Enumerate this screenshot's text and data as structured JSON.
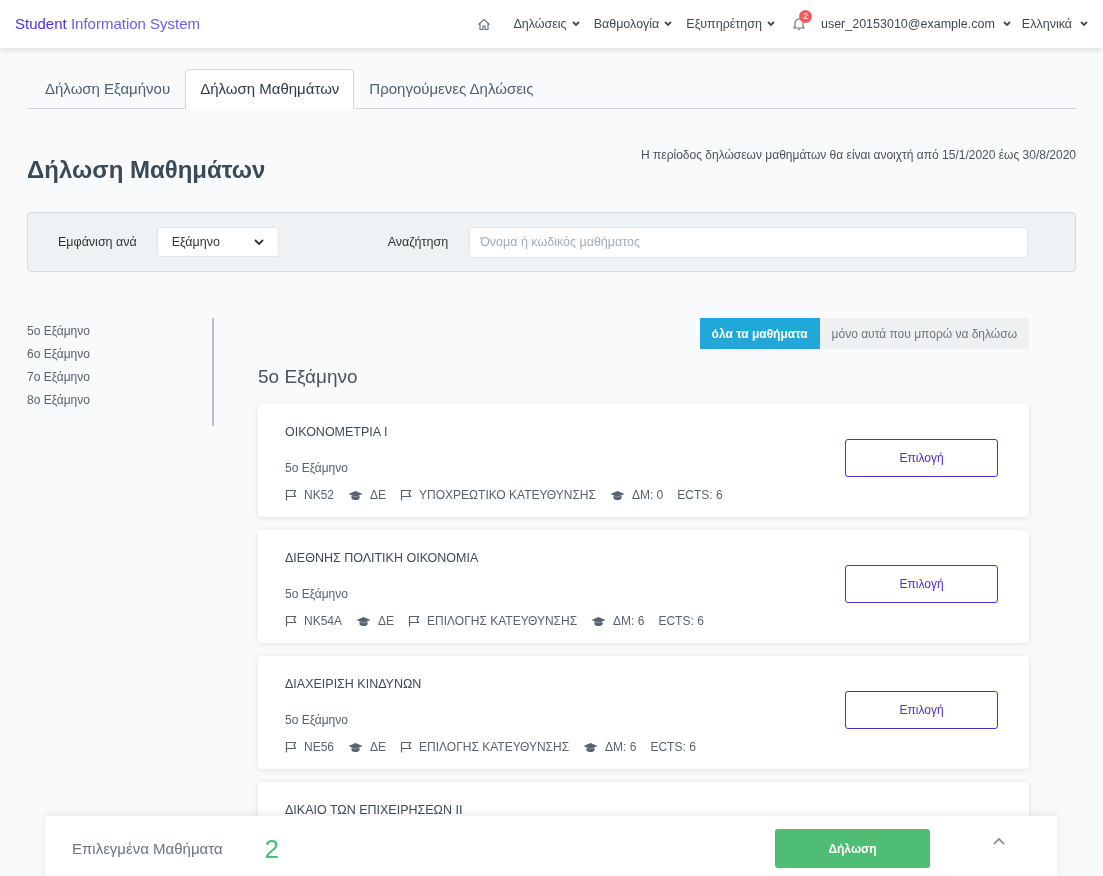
{
  "navbar": {
    "brand_first": "Student",
    "brand_rest": "Information System",
    "menus": [
      {
        "label": "Δηλώσεις"
      },
      {
        "label": "Βαθμολογία"
      },
      {
        "label": "Εξυπηρέτηση"
      }
    ],
    "notifications": "2",
    "user": "user_20153010@example.com",
    "language": "Ελληνικά"
  },
  "tabs": [
    {
      "label": "Δήλωση Εξαμήνου",
      "selected": false
    },
    {
      "label": "Δήλωση Μαθημάτων",
      "selected": true
    },
    {
      "label": "Προηγούμενες Δηλώσεις",
      "selected": false
    }
  ],
  "heading": "Δήλωση Μαθημάτων",
  "period_note": "Η περίοδος δηλώσεων μαθημάτων θα είναι ανοιχτή από 15/1/2020 έως 30/8/2020",
  "filters": {
    "show_by_label": "Εμφάνιση ανά",
    "show_by_value": "Εξάμηνο",
    "search_label": "Αναζήτηση",
    "search_placeholder": "Όνομα ή κωδικός μαθήματος"
  },
  "semesters": [
    "5ο Εξάμηνο",
    "6ο Εξάμηνο",
    "7ο Εξάμηνο",
    "8ο Εξάμηνο"
  ],
  "toggle": [
    {
      "label": "όλα τα μαθήματα",
      "selected": true
    },
    {
      "label": "μόνο αυτά που μπορώ να δηλώσω",
      "selected": false
    }
  ],
  "section_title": "5ο Εξάμηνο",
  "courses": [
    {
      "title": "ΟΙΚΟΝΟΜΕΤΡΙΑ Ι",
      "semester": "5ο Εξάμηνο",
      "button": "Επιλογή",
      "meta": [
        {
          "kind": "flag",
          "text": "NK52"
        },
        {
          "kind": "cap",
          "text": "ΔΕ"
        },
        {
          "kind": "flag",
          "text": "ΥΠΟΧΡΕΩΤΙΚΟ ΚΑΤΕΥΘΥΝΣΗΣ"
        },
        {
          "kind": "cap",
          "text": "ΔΜ: 0"
        },
        {
          "kind": "plain",
          "text": "ECTS: 6"
        }
      ]
    },
    {
      "title": "ΔΙΕΘΝΗΣ ΠΟΛΙΤΙΚΗ ΟΙΚΟΝΟΜΙΑ",
      "semester": "5ο Εξάμηνο",
      "button": "Επιλογή",
      "meta": [
        {
          "kind": "flag",
          "text": "NK54A"
        },
        {
          "kind": "cap",
          "text": "ΔΕ"
        },
        {
          "kind": "flag",
          "text": "ΕΠΙΛΟΓΗΣ ΚΑΤΕΥΘΥΝΣΗΣ"
        },
        {
          "kind": "cap",
          "text": "ΔΜ: 6"
        },
        {
          "kind": "plain",
          "text": "ECTS: 6"
        }
      ]
    },
    {
      "title": "ΔΙΑΧΕΙΡΙΣΗ ΚΙΝΔΥΝΩΝ",
      "semester": "5ο Εξάμηνο",
      "button": "Επιλογή",
      "meta": [
        {
          "kind": "flag",
          "text": "NE56"
        },
        {
          "kind": "cap",
          "text": "ΔΕ"
        },
        {
          "kind": "flag",
          "text": "ΕΠΙΛΟΓΗΣ ΚΑΤΕΥΘΥΝΣΗΣ"
        },
        {
          "kind": "cap",
          "text": "ΔΜ: 6"
        },
        {
          "kind": "plain",
          "text": "ECTS: 6"
        }
      ]
    },
    {
      "title": "ΔΙΚΑΙΟ ΤΩΝ ΕΠΙΧΕΙΡΗΣΕΩΝ ΙΙ"
    }
  ],
  "footer": {
    "label": "Επιλεγμένα Μαθήματα",
    "count": "2",
    "button": "Δήλωση"
  }
}
